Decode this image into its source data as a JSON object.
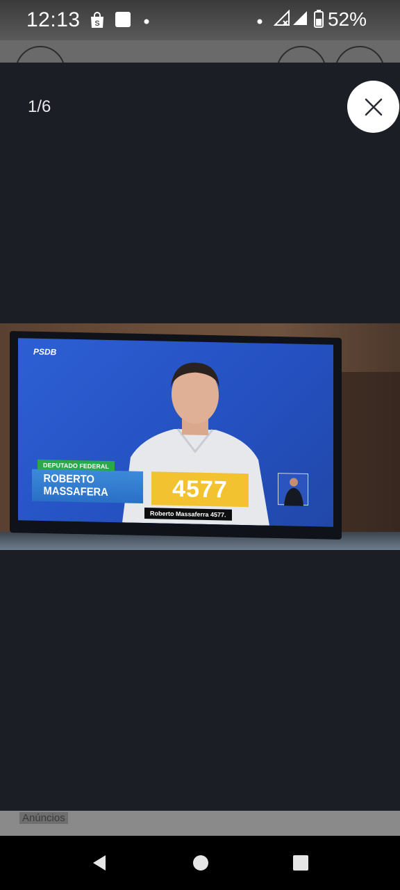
{
  "status_bar": {
    "time": "12:13",
    "battery_percent": "52%",
    "icons": [
      "shopping-bag-icon",
      "square-icon",
      "dot-icon",
      "dot-icon",
      "no-signal-icon",
      "signal-icon",
      "battery-icon"
    ]
  },
  "viewer": {
    "counter": "1/6",
    "close_icon": "close-icon"
  },
  "photo": {
    "tv": {
      "party_logo": "PSDB",
      "role_tag": "DEPUTADO FEDERAL",
      "candidate_name": "ROBERTO MASSAFERA",
      "candidate_number": "4577",
      "caption": "Roberto Massaferra 4577."
    }
  },
  "ad_strip": {
    "label": "Anúncios"
  },
  "nav_bar": {
    "icons": [
      "back-icon",
      "home-icon",
      "recents-icon"
    ]
  },
  "colors": {
    "overlay_bg": "#1b1e25",
    "tv_blue": "#2d5fd4",
    "number_yellow": "#f2c230",
    "tag_green": "#2aa84a"
  }
}
